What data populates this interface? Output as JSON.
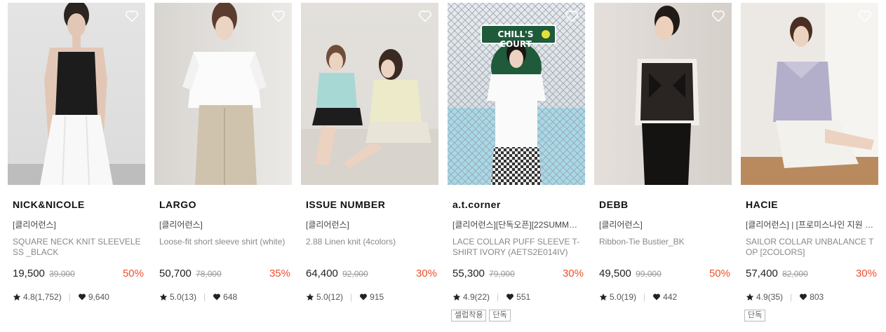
{
  "products": [
    {
      "brand": "NICK&NICOLE",
      "tagline": "[클리어런스]",
      "name": "SQUARE NECK KNIT SLEEVELESS _BLACK",
      "price": "19,500",
      "original_price": "39,000",
      "discount": "50%",
      "rating": "4.8(1,752)",
      "likes": "9,640",
      "badges": []
    },
    {
      "brand": "LARGO",
      "tagline": "[클리어런스]",
      "name": "Loose-fit short sleeve shirt (white)",
      "price": "50,700",
      "original_price": "78,000",
      "discount": "35%",
      "rating": "5.0(13)",
      "likes": "648",
      "badges": []
    },
    {
      "brand": "ISSUE NUMBER",
      "tagline": "[클리어런스]",
      "name": "2.88 Linen knit (4colors)",
      "price": "64,400",
      "original_price": "92,000",
      "discount": "30%",
      "rating": "5.0(12)",
      "likes": "915",
      "badges": []
    },
    {
      "brand": "a.t.corner",
      "tagline": "[클리어런스][단독오픈][22SUMM…",
      "name": "LACE COLLAR PUFF SLEEVE T-SHIRT IVORY (AETS2E014IV)",
      "price": "55,300",
      "original_price": "79,000",
      "discount": "30%",
      "rating": "4.9(22)",
      "likes": "551",
      "badges": [
        "셀럽착용",
        "단독"
      ],
      "image_sign": "CHILL'S COURT"
    },
    {
      "brand": "DEBB",
      "tagline": "[클리어런스]",
      "name": "Ribbon-Tie Bustier_BK",
      "price": "49,500",
      "original_price": "99,000",
      "discount": "50%",
      "rating": "5.0(19)",
      "likes": "442",
      "badges": []
    },
    {
      "brand": "HACIE",
      "tagline": "[클리어런스] | [프로미스나인 지원 …",
      "name": "SAILOR COLLAR UNBALANCE TOP [2COLORS]",
      "price": "57,400",
      "original_price": "82,000",
      "discount": "30%",
      "rating": "4.9(35)",
      "likes": "803",
      "badges": [
        "단독"
      ]
    }
  ],
  "colors": {
    "discount": "#f04e2a",
    "text": "#222222",
    "muted": "#888888"
  },
  "icons": {
    "wishlist": "heart-outline-icon",
    "rating": "star-icon",
    "likes": "heart-filled-icon"
  }
}
